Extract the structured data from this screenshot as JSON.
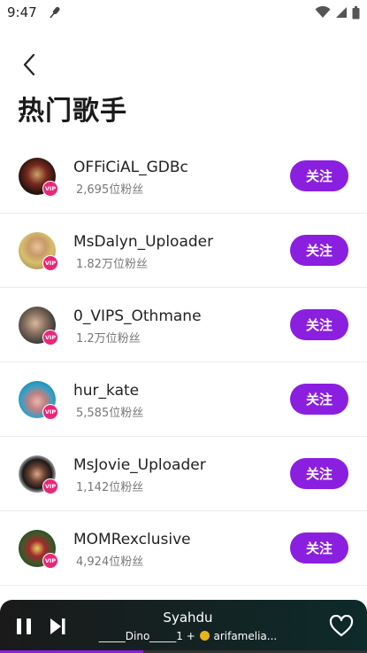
{
  "status_bar": {
    "time": "9:47"
  },
  "header": {
    "title": "热门歌手"
  },
  "artists": [
    {
      "name": "OFFiCiAL_GDBc",
      "fans": "2,695位粉丝",
      "follow_label": "关注",
      "vip": "VIP"
    },
    {
      "name": "MsDalyn_Uploader",
      "fans": "1.82万位粉丝",
      "follow_label": "关注",
      "vip": "VIP"
    },
    {
      "name": "0_VIPS_Othmane",
      "fans": "1.2万位粉丝",
      "follow_label": "关注",
      "vip": "VIP"
    },
    {
      "name": "hur_kate",
      "fans": "5,585位粉丝",
      "follow_label": "关注",
      "vip": "VIP"
    },
    {
      "name": "MsJovie_Uploader",
      "fans": "1,142位粉丝",
      "follow_label": "关注",
      "vip": "VIP"
    },
    {
      "name": "MOMRexclusive",
      "fans": "4,924位粉丝",
      "follow_label": "关注",
      "vip": "VIP"
    }
  ],
  "player": {
    "title": "Syahdu",
    "artists_prefix": "_____Dino_____1 +",
    "artists_suffix": "arifamelia...",
    "progress": 0.39
  },
  "colors": {
    "accent": "#8a1fe0",
    "vip": "#e8277a"
  }
}
